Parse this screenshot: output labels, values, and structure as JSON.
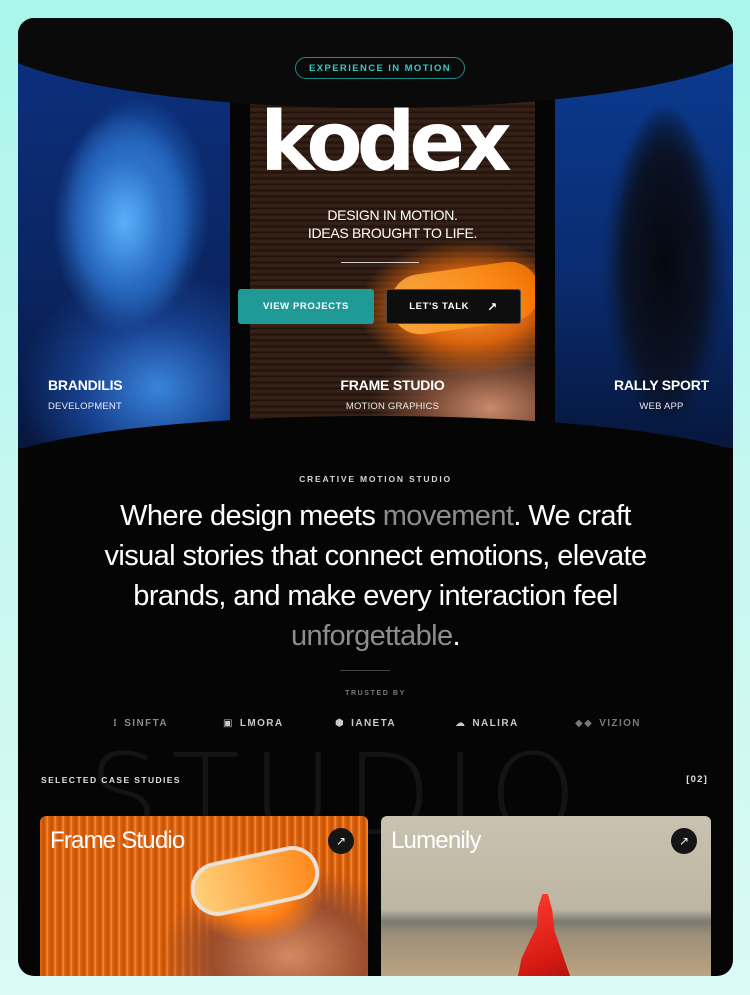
{
  "hero": {
    "badge": "EXPERIENCE IN MOTION",
    "logo_text": "kodex",
    "tagline_line1": "DESIGN IN MOTION.",
    "tagline_line2": "IDEAS BROUGHT TO LIFE.",
    "primary_button": "VIEW PROJECTS",
    "secondary_button": "LET'S TALK",
    "secondary_button_icon": "arrow-up-right-icon",
    "panels": [
      {
        "title": "BRANDILIS",
        "subtitle": "DEVELOPMENT"
      },
      {
        "title": "FRAME STUDIO",
        "subtitle": "MOTION GRAPHICS"
      },
      {
        "title": "RALLY SPORT",
        "subtitle": "WEB APP"
      }
    ]
  },
  "manifesto": {
    "eyebrow": "CREATIVE MOTION STUDIO",
    "part1": "Where design meets ",
    "highlight1": "movement",
    "part2": ". We craft visual stories that connect emotions, elevate brands, and make every interaction feel ",
    "highlight2": "unforgettable",
    "part3": "."
  },
  "trusted": {
    "label": "TRUSTED BY",
    "logos": [
      {
        "name": "SINFTA",
        "icon": "sinfta-mark-icon"
      },
      {
        "name": "LMORA",
        "icon": "lmora-mark-icon"
      },
      {
        "name": "IANETA",
        "icon": "ianeta-mark-icon"
      },
      {
        "name": "NALIRA",
        "icon": "nalira-mark-icon"
      },
      {
        "name": "VIZION",
        "icon": "vizion-mark-icon"
      }
    ]
  },
  "case_studies": {
    "label": "SELECTED CASE STUDIES",
    "count": "[02]",
    "background_word": "STUDIO",
    "cards": [
      {
        "title": "Frame Studio",
        "icon": "arrow-up-right-icon"
      },
      {
        "title": "Lumenily",
        "icon": "arrow-up-right-icon"
      }
    ]
  },
  "colors": {
    "accent": "#1f9a97",
    "badge_text": "#34c8c0",
    "background": "#050505",
    "page_background": "#b8f5ee"
  }
}
